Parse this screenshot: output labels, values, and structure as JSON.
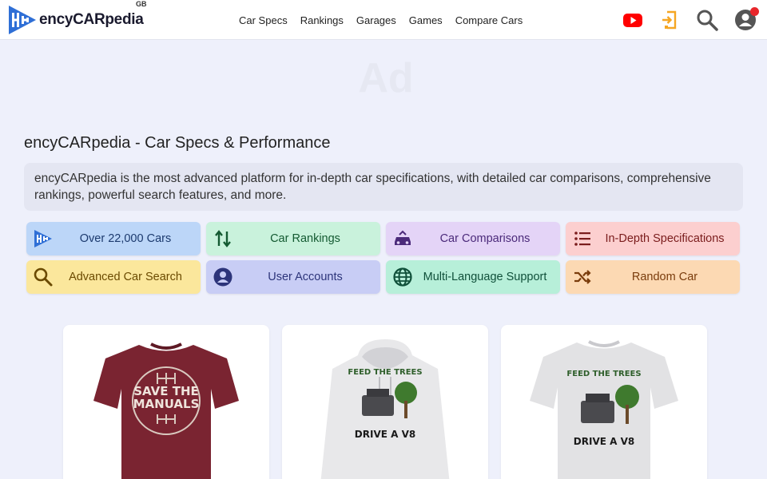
{
  "header": {
    "logo_text": "encyCARpedia",
    "region": "GB",
    "nav": [
      "Car Specs",
      "Rankings",
      "Garages",
      "Games",
      "Compare Cars"
    ],
    "icons": [
      "youtube-icon",
      "login-icon",
      "search-icon",
      "account-icon"
    ]
  },
  "ad": {
    "label": "Ad"
  },
  "main": {
    "title": "encyCARpedia - Car Specs & Performance",
    "intro": "encyCARpedia is the most advanced platform for in-depth car specifications, with detailed car comparisons, comprehensive rankings, powerful search features, and more."
  },
  "features": [
    {
      "label": "Over 22,000 Cars",
      "icon": "logo-icon",
      "bg": "#bcd6f8",
      "fg": "#1c3a6e"
    },
    {
      "label": "Car Rankings",
      "icon": "sort-arrows-icon",
      "bg": "#c9f2dc",
      "fg": "#145a32"
    },
    {
      "label": "Car Comparisons",
      "icon": "car-compare-icon",
      "bg": "#e4d4f7",
      "fg": "#4b2a7a"
    },
    {
      "label": "In-Depth Specifications",
      "icon": "list-icon",
      "bg": "#fccfcf",
      "fg": "#7a1c1c"
    },
    {
      "label": "Advanced Car Search",
      "icon": "search-icon",
      "bg": "#fbe79c",
      "fg": "#6b4a00"
    },
    {
      "label": "User Accounts",
      "icon": "user-icon",
      "bg": "#c8cdf5",
      "fg": "#2c347a"
    },
    {
      "label": "Multi-Language Support",
      "icon": "globe-icon",
      "bg": "#b7efd9",
      "fg": "#10503a"
    },
    {
      "label": "Random Car",
      "icon": "shuffle-icon",
      "bg": "#fcd9b3",
      "fg": "#7a3c0c"
    }
  ],
  "products": [
    {
      "text_top": "SAVE THE",
      "text_bottom": "MANUALS",
      "garment": "t-shirt",
      "color": "#7a2431"
    },
    {
      "text_top": "FEED THE TREES",
      "text_bottom": "DRIVE A V8",
      "garment": "hoodie",
      "color": "#e8e8ea"
    },
    {
      "text_top": "FEED THE TREES",
      "text_bottom": "DRIVE A V8",
      "garment": "t-shirt",
      "color": "#e2e2e4"
    }
  ]
}
